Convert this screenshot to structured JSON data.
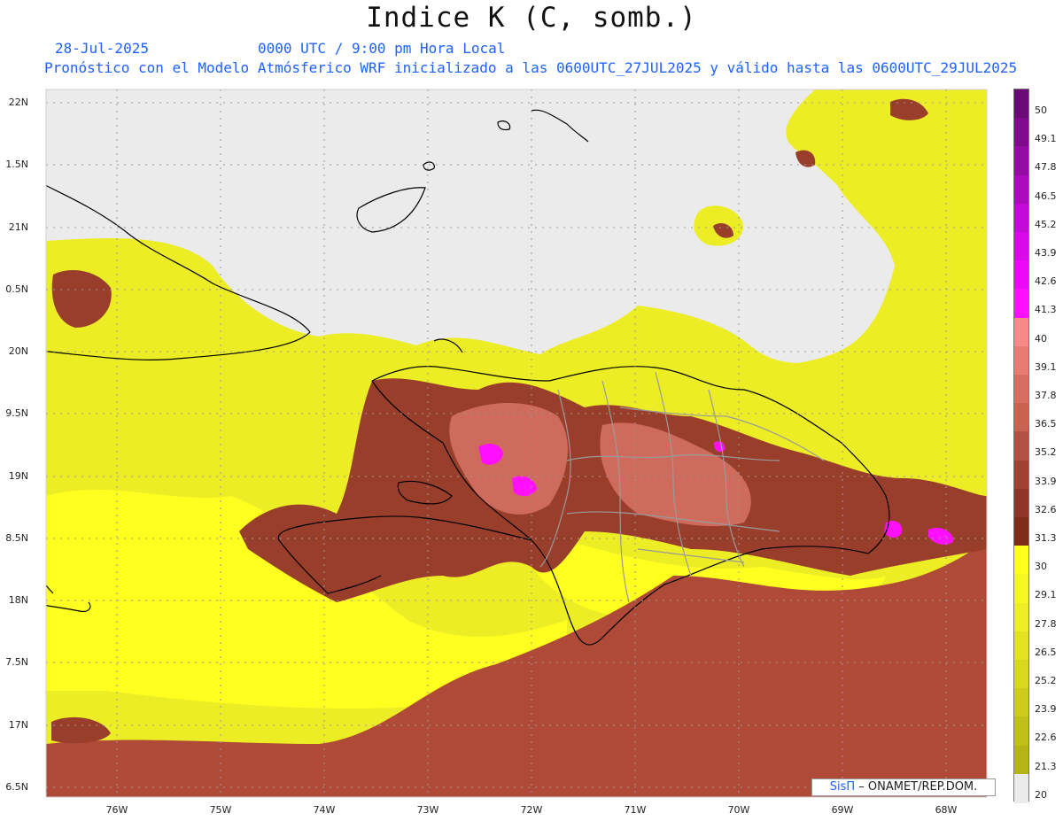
{
  "header": {
    "title": "Indice K (C, somb.)",
    "date": "28-Jul-2025",
    "utc_time": "0000 UTC / 9:00 pm Hora Local",
    "model_info": "Pronóstico con el Modelo Atmósferico WRF inicializado a las 0600UTC_27JUL2025 y válido hasta las  0600UTC_29JUL2025"
  },
  "map": {
    "lat_labels": [
      "22N",
      "1.5N",
      "21N",
      "0.5N",
      "20N",
      "9.5N",
      "19N",
      "8.5N",
      "18N",
      "7.5N",
      "17N",
      "6.5N"
    ],
    "lon_labels": [
      "76W",
      "75W",
      "74W",
      "73W",
      "72W",
      "71W",
      "70W",
      "69W",
      "68W"
    ],
    "land_mask_color": "#ebebeb",
    "coastline_color": "#000000",
    "province_border_color": "#999999"
  },
  "colorbar": {
    "labels": [
      "50",
      "49.1",
      "47.8",
      "46.5",
      "45.2",
      "43.9",
      "42.6",
      "41.3",
      "40",
      "39.1",
      "37.8",
      "36.5",
      "35.2",
      "33.9",
      "32.6",
      "31.3",
      "30",
      "29.1",
      "27.8",
      "26.5",
      "25.2",
      "23.9",
      "22.6",
      "21.3",
      "20"
    ],
    "colors": [
      "#6a0a74",
      "#800a8c",
      "#960aa6",
      "#ac0ac0",
      "#c40ad6",
      "#d80ae8",
      "#ea0af6",
      "#ff10ff",
      "#f78a86",
      "#e87c72",
      "#d86e60",
      "#c9624f",
      "#b45040",
      "#a04232",
      "#8e3626",
      "#7d2c18",
      "#ffff20",
      "#f6f626",
      "#eeee28",
      "#e2e222",
      "#d8d820",
      "#cccc1c",
      "#c0c01a",
      "#b4b418",
      "#ebebeb"
    ]
  },
  "credit": {
    "brand": "SisΠ",
    "text": "– ONAMET/REP.DOM."
  }
}
